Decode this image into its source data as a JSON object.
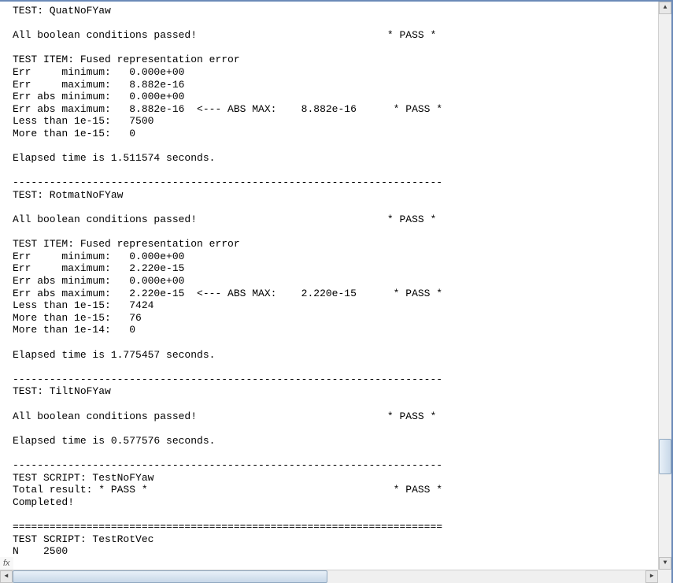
{
  "console": {
    "lines": [
      "TEST: QuatNoFYaw",
      "",
      "All boolean conditions passed!                               * PASS *",
      "",
      "TEST ITEM: Fused representation error",
      "Err     minimum:   0.000e+00",
      "Err     maximum:   8.882e-16",
      "Err abs minimum:   0.000e+00",
      "Err abs maximum:   8.882e-16  <--- ABS MAX:    8.882e-16      * PASS *",
      "Less than 1e-15:   7500",
      "More than 1e-15:   0",
      "",
      "Elapsed time is 1.511574 seconds.",
      "",
      "----------------------------------------------------------------------",
      "TEST: RotmatNoFYaw",
      "",
      "All boolean conditions passed!                               * PASS *",
      "",
      "TEST ITEM: Fused representation error",
      "Err     minimum:   0.000e+00",
      "Err     maximum:   2.220e-15",
      "Err abs minimum:   0.000e+00",
      "Err abs maximum:   2.220e-15  <--- ABS MAX:    2.220e-15      * PASS *",
      "Less than 1e-15:   7424",
      "More than 1e-15:   76",
      "More than 1e-14:   0",
      "",
      "Elapsed time is 1.775457 seconds.",
      "",
      "----------------------------------------------------------------------",
      "TEST: TiltNoFYaw",
      "",
      "All boolean conditions passed!                               * PASS *",
      "",
      "Elapsed time is 0.577576 seconds.",
      "",
      "----------------------------------------------------------------------",
      "TEST SCRIPT: TestNoFYaw",
      "Total result: * PASS *                                        * PASS *",
      "Completed!",
      "",
      "======================================================================",
      "TEST SCRIPT: TestRotVec",
      "N    2500"
    ]
  },
  "fx_label": "fx",
  "arrows": {
    "up": "▲",
    "down": "▼",
    "left": "◄",
    "right": "►"
  }
}
